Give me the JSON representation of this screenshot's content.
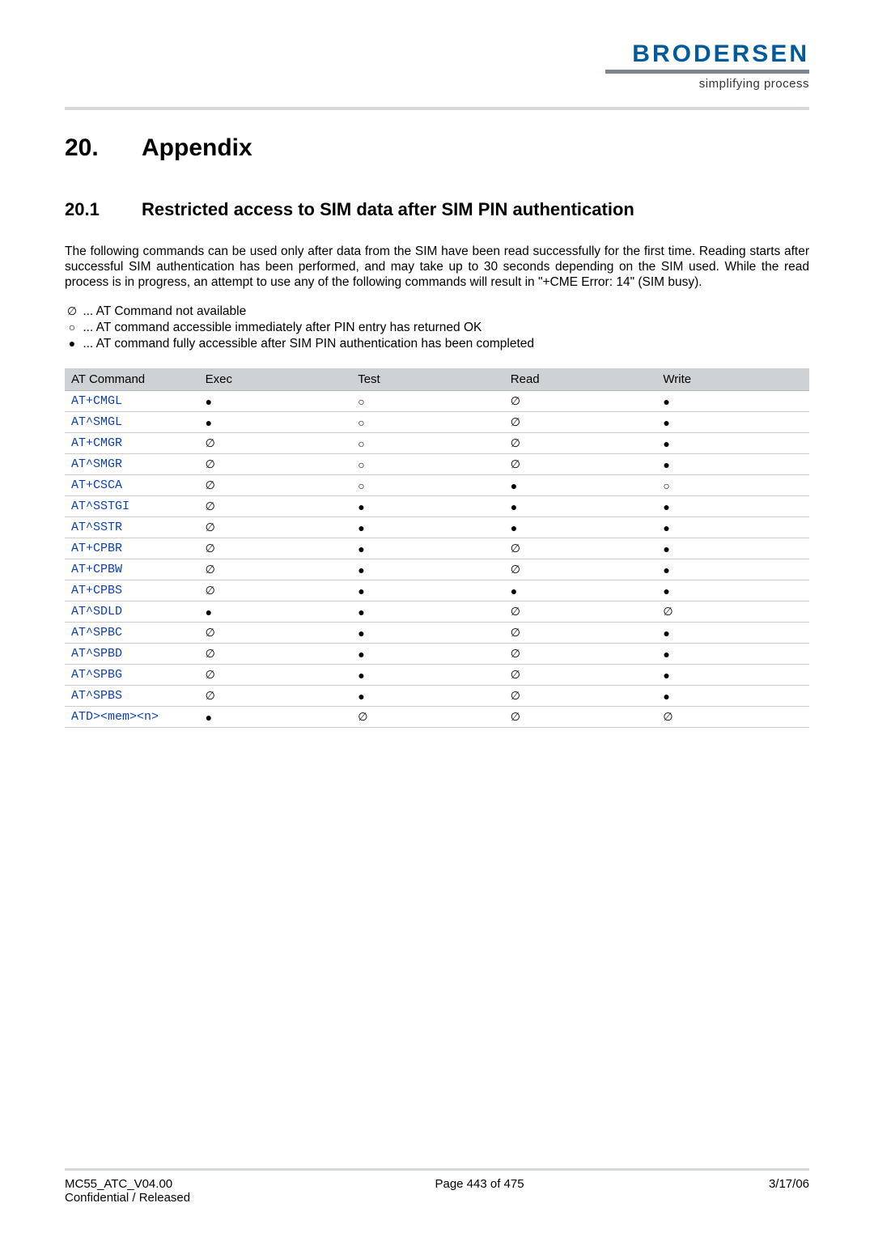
{
  "header": {
    "logo_text": "BRODERSEN",
    "tagline": "simplifying process"
  },
  "chapter": {
    "num": "20.",
    "title": "Appendix"
  },
  "section": {
    "num": "20.1",
    "title": "Restricted access to SIM data after SIM PIN authentication"
  },
  "intro": "The following commands can be used only after data from the SIM have been read successfully for the first time. Reading starts after successful SIM authentication has been performed, and may take up to 30 seconds depending on the SIM used. While the read process is in progress, an attempt to use any of the following commands will result in \"+CME Error: 14\" (SIM busy).",
  "legend": {
    "na": "... AT Command not available",
    "open": "... AT command accessible immediately after PIN entry has returned OK",
    "full": "... AT command fully accessible after SIM PIN authentication has been completed"
  },
  "symbols": {
    "na": "∅",
    "open": "○",
    "full": "●"
  },
  "table": {
    "headers": [
      "AT Command",
      "Exec",
      "Test",
      "Read",
      "Write"
    ],
    "rows": [
      {
        "cmd": "AT+CMGL",
        "exec": "full",
        "test": "open",
        "read": "na",
        "write": "full"
      },
      {
        "cmd": "AT^SMGL",
        "exec": "full",
        "test": "open",
        "read": "na",
        "write": "full"
      },
      {
        "cmd": "AT+CMGR",
        "exec": "na",
        "test": "open",
        "read": "na",
        "write": "full"
      },
      {
        "cmd": "AT^SMGR",
        "exec": "na",
        "test": "open",
        "read": "na",
        "write": "full"
      },
      {
        "cmd": "AT+CSCA",
        "exec": "na",
        "test": "open",
        "read": "full",
        "write": "open"
      },
      {
        "cmd": "AT^SSTGI",
        "exec": "na",
        "test": "full",
        "read": "full",
        "write": "full"
      },
      {
        "cmd": "AT^SSTR",
        "exec": "na",
        "test": "full",
        "read": "full",
        "write": "full"
      },
      {
        "cmd": "AT+CPBR",
        "exec": "na",
        "test": "full",
        "read": "na",
        "write": "full"
      },
      {
        "cmd": "AT+CPBW",
        "exec": "na",
        "test": "full",
        "read": "na",
        "write": "full"
      },
      {
        "cmd": "AT+CPBS",
        "exec": "na",
        "test": "full",
        "read": "full",
        "write": "full"
      },
      {
        "cmd": "AT^SDLD",
        "exec": "full",
        "test": "full",
        "read": "na",
        "write": "na"
      },
      {
        "cmd": "AT^SPBC",
        "exec": "na",
        "test": "full",
        "read": "na",
        "write": "full"
      },
      {
        "cmd": "AT^SPBD",
        "exec": "na",
        "test": "full",
        "read": "na",
        "write": "full"
      },
      {
        "cmd": "AT^SPBG",
        "exec": "na",
        "test": "full",
        "read": "na",
        "write": "full"
      },
      {
        "cmd": "AT^SPBS",
        "exec": "na",
        "test": "full",
        "read": "na",
        "write": "full"
      },
      {
        "cmd": "ATD><mem><n>",
        "exec": "full",
        "test": "na",
        "read": "na",
        "write": "na"
      }
    ]
  },
  "footer": {
    "doc_id": "MC55_ATC_V04.00",
    "confidentiality": "Confidential / Released",
    "page": "Page 443 of 475",
    "date": "3/17/06"
  }
}
